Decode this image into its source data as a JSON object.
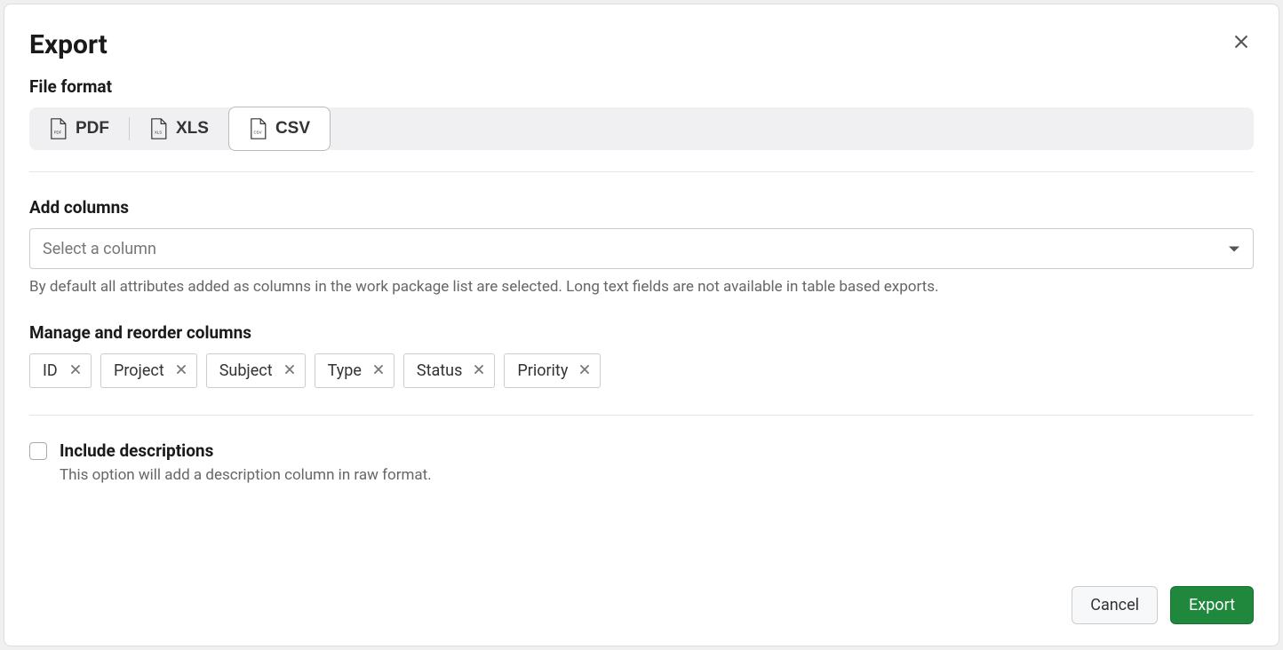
{
  "dialog": {
    "title": "Export",
    "file_format_label": "File format",
    "formats": [
      {
        "label": "PDF",
        "badge": "PDF",
        "selected": false
      },
      {
        "label": "XLS",
        "badge": "XLS",
        "selected": false
      },
      {
        "label": "CSV",
        "badge": "CSV",
        "selected": true
      }
    ],
    "add_columns_label": "Add columns",
    "select_placeholder": "Select a column",
    "hint": "By default all attributes added as columns in the work package list are selected. Long text fields are not available in table based exports.",
    "manage_label": "Manage and reorder columns",
    "columns": [
      "ID",
      "Project",
      "Subject",
      "Type",
      "Status",
      "Priority"
    ],
    "include_desc_label": "Include descriptions",
    "include_desc_hint": "This option will add a description column in raw format.",
    "cancel_label": "Cancel",
    "export_label": "Export"
  }
}
